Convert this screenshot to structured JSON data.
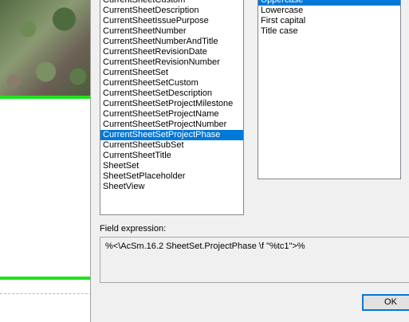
{
  "field_names": [
    "CurrentSheetCustom",
    "CurrentSheetDescription",
    "CurrentSheetIssuePurpose",
    "CurrentSheetNumber",
    "CurrentSheetNumberAndTitle",
    "CurrentSheetRevisionDate",
    "CurrentSheetRevisionNumber",
    "CurrentSheetSet",
    "CurrentSheetSetCustom",
    "CurrentSheetSetDescription",
    "CurrentSheetSetProjectMilestone",
    "CurrentSheetSetProjectName",
    "CurrentSheetSetProjectNumber",
    "CurrentSheetSetProjectPhase",
    "CurrentSheetSubSet",
    "CurrentSheetTitle",
    "SheetSet",
    "SheetSetPlaceholder",
    "SheetView"
  ],
  "selected_field": "CurrentSheetSetProjectPhase",
  "formats": [
    "Uppercase",
    "Lowercase",
    "First capital",
    "Title case"
  ],
  "selected_format": "Uppercase",
  "field_expression_label": "Field expression:",
  "field_expression": "%<\\AcSm.16.2 SheetSet.ProjectPhase \\f \"%tc1\">%",
  "ok_label": "OK",
  "colors": {
    "selection": "#0078d7",
    "accent_line": "#1de41d"
  }
}
